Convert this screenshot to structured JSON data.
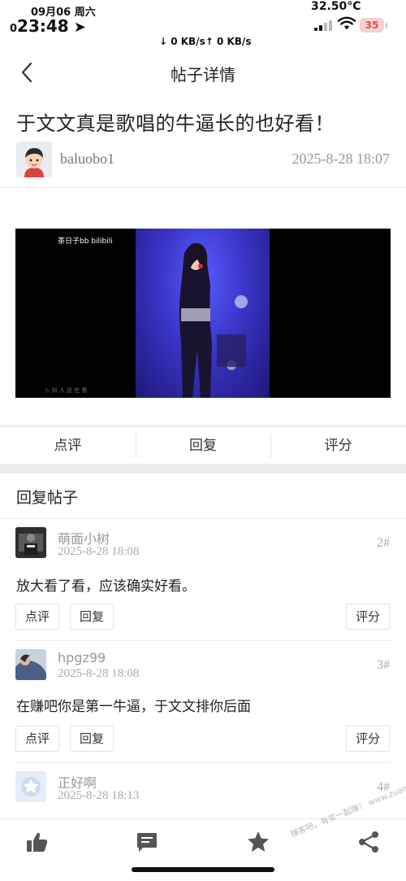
{
  "status_bar": {
    "date": "09月06 周六",
    "time_prefix": "0",
    "time": "23:48",
    "temperature": "32.50°C",
    "network": "↓ 0 KB/s↑ 0 KB/s",
    "battery": "35"
  },
  "nav": {
    "title": "帖子详情"
  },
  "post": {
    "title": "于文文真是歌唱的牛逼长的也好看！",
    "author": "baluobo1",
    "time": "2025-8-28 18:07",
    "video_watermark": "茶日子bb bilibili"
  },
  "post_actions": [
    "点评",
    "回复",
    "评分"
  ],
  "replies_header": "回复帖子",
  "replies": [
    {
      "name": "萌面小树",
      "time": "2025-8-28 18:08",
      "floor": "2#",
      "content": "放大看了看，应该确实好看。",
      "buttons": {
        "comment": "点评",
        "reply": "回复",
        "rate": "评分"
      }
    },
    {
      "name": "hpgz99",
      "time": "2025-8-28 18:08",
      "floor": "3#",
      "content": "在赚吧你是第一牛逼，于文文排你后面",
      "buttons": {
        "comment": "点评",
        "reply": "回复",
        "rate": "评分"
      }
    },
    {
      "name": "正好啊",
      "time": "2025-8-28 18:13",
      "floor": "4#"
    }
  ],
  "tabbar": {
    "icons": [
      "thumbs-up-icon",
      "message-icon",
      "star-icon",
      "share-icon"
    ],
    "watermark": "赚客吧，有奖一起赚！ www.zuanke8.com"
  },
  "colors": {
    "icon": "#555555",
    "divider": "#ececec",
    "muted_text": "#999999"
  }
}
